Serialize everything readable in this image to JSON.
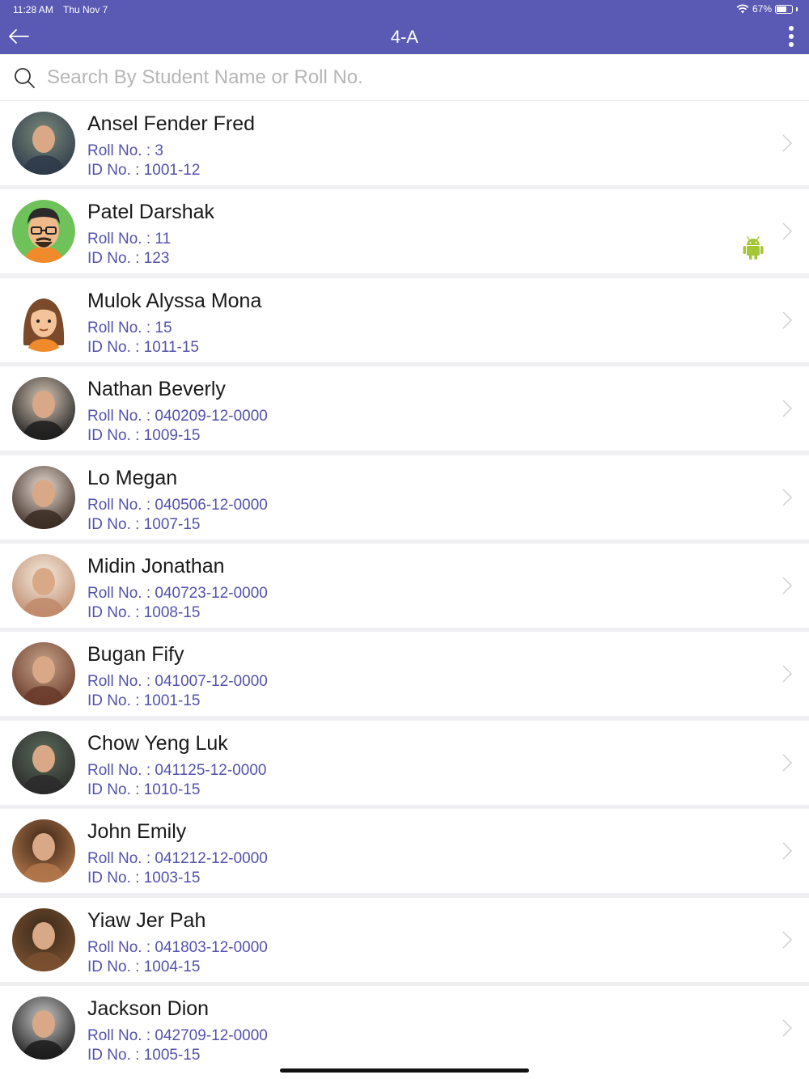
{
  "status": {
    "time": "11:28 AM",
    "date": "Thu Nov 7",
    "battery": "67%",
    "battery_level": 0.67
  },
  "header": {
    "title": "4-A"
  },
  "colors": {
    "header_bg": "#5a59b3",
    "accent_text": "#5352ad",
    "android_green": "#a4c639"
  },
  "search": {
    "placeholder": "Search By Student Name or Roll No."
  },
  "students": [
    {
      "name": "Ansel Fender Fred",
      "roll": "Roll No. : 3",
      "id": "ID No. : 1001-12",
      "avatar": "photo"
    },
    {
      "name": "Patel Darshak",
      "roll": "Roll No. : 11",
      "id": "ID No. : 123",
      "avatar": "cartoon-man",
      "platform_icon": "android-icon"
    },
    {
      "name": "Mulok Alyssa Mona",
      "roll": "Roll No. : 15",
      "id": "ID No. : 1011-15",
      "avatar": "cartoon-woman"
    },
    {
      "name": "Nathan Beverly",
      "roll": "Roll No. : 040209-12-0000",
      "id": "ID No. : 1009-15",
      "avatar": "photo"
    },
    {
      "name": "Lo Megan",
      "roll": "Roll No. : 040506-12-0000",
      "id": "ID No. : 1007-15",
      "avatar": "photo"
    },
    {
      "name": "Midin Jonathan",
      "roll": "Roll No. : 040723-12-0000",
      "id": "ID No. : 1008-15",
      "avatar": "photo"
    },
    {
      "name": "Bugan Fify",
      "roll": "Roll No. : 041007-12-0000",
      "id": "ID No. : 1001-15",
      "avatar": "photo"
    },
    {
      "name": "Chow Yeng Luk",
      "roll": "Roll No. : 041125-12-0000",
      "id": "ID No. : 1010-15",
      "avatar": "photo"
    },
    {
      "name": "John Emily",
      "roll": "Roll No. : 041212-12-0000",
      "id": "ID No. : 1003-15",
      "avatar": "photo"
    },
    {
      "name": "Yiaw Jer Pah",
      "roll": "Roll No. : 041803-12-0000",
      "id": "ID No. : 1004-15",
      "avatar": "photo"
    },
    {
      "name": "Jackson Dion",
      "roll": "Roll No. : 042709-12-0000",
      "id": "ID No. : 1005-15",
      "avatar": "photo"
    }
  ]
}
